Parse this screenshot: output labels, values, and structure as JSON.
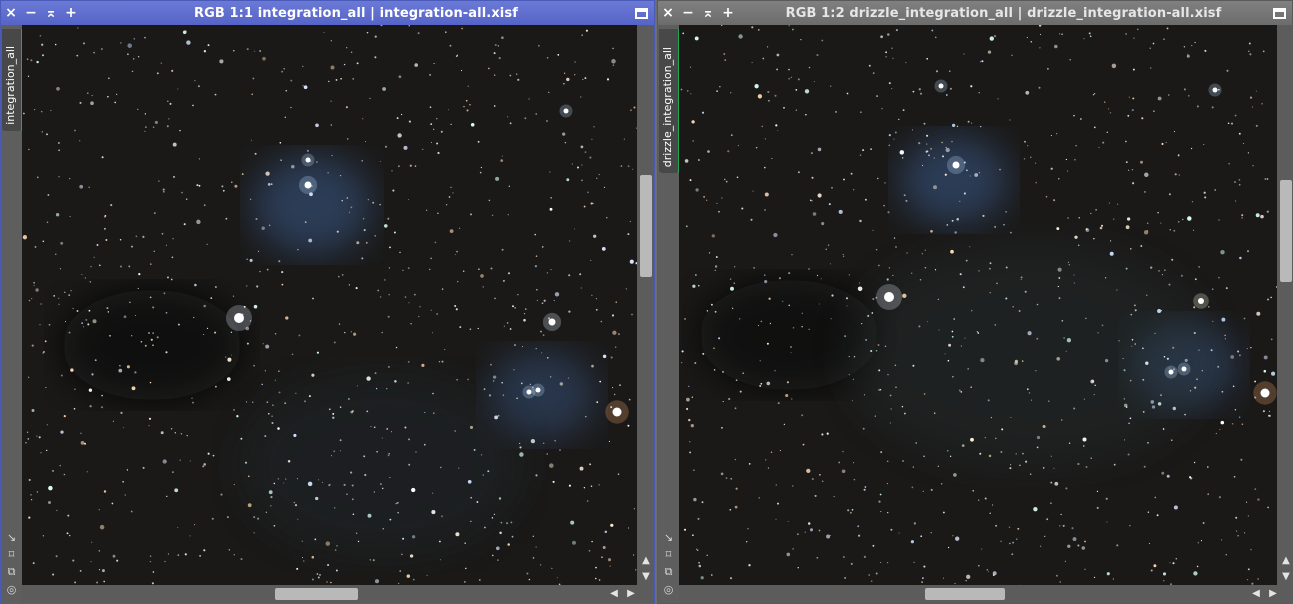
{
  "window1": {
    "title": "RGB 1:1 integration_all | integration-all.xisf",
    "tab_label": "integration_all",
    "buttons": {
      "close": "×",
      "minimize": "−",
      "shade": "⌅",
      "maximize_plus": "+"
    }
  },
  "window2": {
    "title": "RGB 1:2 drizzle_integration_all | drizzle_integration-all.xisf",
    "tab_label": "drizzle_integration_all",
    "buttons": {
      "close": "×",
      "minimize": "−",
      "shade": "⌅",
      "maximize_plus": "+"
    }
  },
  "side_icons": [
    "↘",
    "⌑",
    "⧉",
    "◎"
  ],
  "arrows": {
    "up": "▲",
    "down": "▼",
    "left": "◀",
    "right": "▶"
  },
  "colors": {
    "active_title": "#5664c8",
    "inactive_title": "#6c6c6c",
    "tab_accent": "#1faa55",
    "sky": "#171717"
  }
}
